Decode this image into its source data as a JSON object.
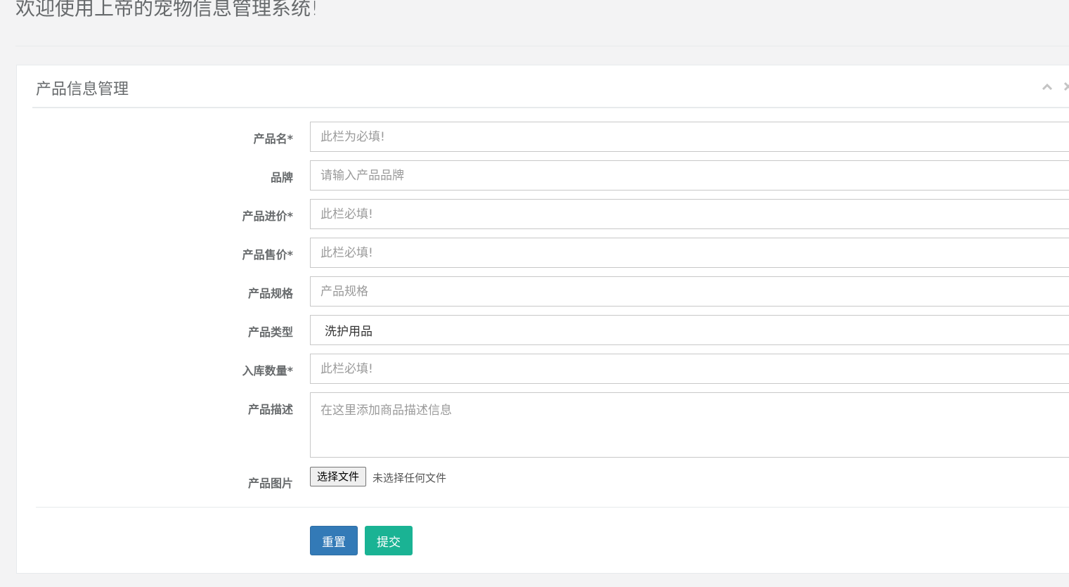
{
  "header": {
    "title": "欢迎使用上帝的宠物信息管理系统!"
  },
  "panel": {
    "title": "产品信息管理",
    "tools": {
      "collapse_icon": "chevron-up-icon",
      "close_icon": "close-icon"
    }
  },
  "form": {
    "name": {
      "label": "产品名*",
      "placeholder": "此栏为必填!",
      "value": ""
    },
    "brand": {
      "label": "品牌",
      "placeholder": "请输入产品品牌",
      "value": ""
    },
    "purchase_price": {
      "label": "产品进价*",
      "placeholder": "此栏必填!",
      "value": ""
    },
    "sale_price": {
      "label": "产品售价*",
      "placeholder": "此栏必填!",
      "value": ""
    },
    "spec": {
      "label": "产品规格",
      "placeholder": "产品规格",
      "value": ""
    },
    "type": {
      "label": "产品类型",
      "selected": "洗护用品"
    },
    "stock": {
      "label": "入库数量*",
      "placeholder": "此栏必填!",
      "value": ""
    },
    "description": {
      "label": "产品描述",
      "placeholder": "在这里添加商品描述信息",
      "value": ""
    },
    "image": {
      "label": "产品图片",
      "button_label": "选择文件",
      "status": "未选择任何文件"
    }
  },
  "actions": {
    "reset_label": "重置",
    "submit_label": "提交"
  },
  "colors": {
    "reset": "#337ab7",
    "submit": "#1ab394",
    "background": "#f3f3f4"
  }
}
